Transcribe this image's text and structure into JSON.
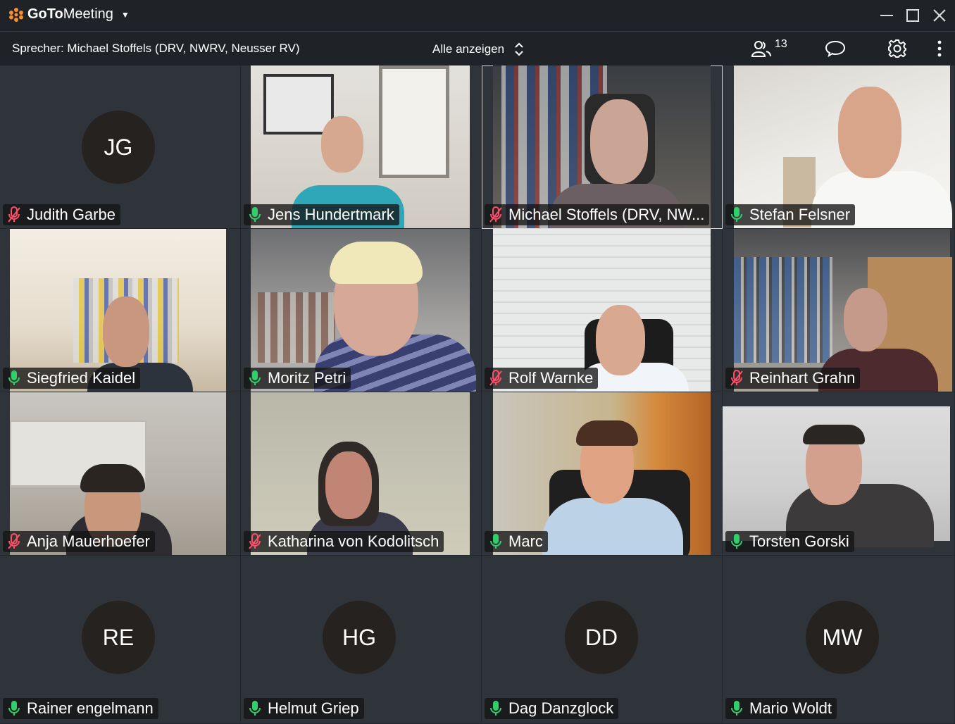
{
  "app": {
    "brand_bold": "GoTo",
    "brand_normal": "Meeting",
    "window_controls": [
      "minimize-icon",
      "maximize-icon",
      "close-icon"
    ]
  },
  "topbar": {
    "speaker": "Sprecher: Michael Stoffels (DRV, NWRV, Neusser RV)",
    "view_label": "Alle anzeigen",
    "participant_count": "13"
  },
  "colors": {
    "accent_orange": "#f68d2e",
    "mic_on": "#2fd06b",
    "mic_muted": "#ff4f6a",
    "background": "#2f343a"
  },
  "tiles": [
    {
      "name": "Judith Garbe",
      "mic": "muted",
      "initials": "JG"
    },
    {
      "name": "Jens Hundertmark",
      "mic": "on"
    },
    {
      "name": "Michael Stoffels (DRV, NW...",
      "mic": "muted"
    },
    {
      "name": "Stefan Felsner",
      "mic": "on"
    },
    {
      "name": "Siegfried Kaidel",
      "mic": "on"
    },
    {
      "name": "Moritz Petri",
      "mic": "on"
    },
    {
      "name": "Rolf Warnke",
      "mic": "muted"
    },
    {
      "name": "Reinhart Grahn",
      "mic": "muted"
    },
    {
      "name": "Anja Mauerhoefer",
      "mic": "muted"
    },
    {
      "name": "Katharina von Kodolitsch",
      "mic": "muted"
    },
    {
      "name": "Marc",
      "mic": "on"
    },
    {
      "name": "Torsten Gorski",
      "mic": "on"
    },
    {
      "name": "Rainer engelmann",
      "mic": "on",
      "initials": "RE"
    },
    {
      "name": "Helmut Griep",
      "mic": "on",
      "initials": "HG"
    },
    {
      "name": "Dag Danzglock",
      "mic": "on",
      "initials": "DD"
    },
    {
      "name": "Mario Woldt",
      "mic": "on",
      "initials": "MW"
    }
  ]
}
